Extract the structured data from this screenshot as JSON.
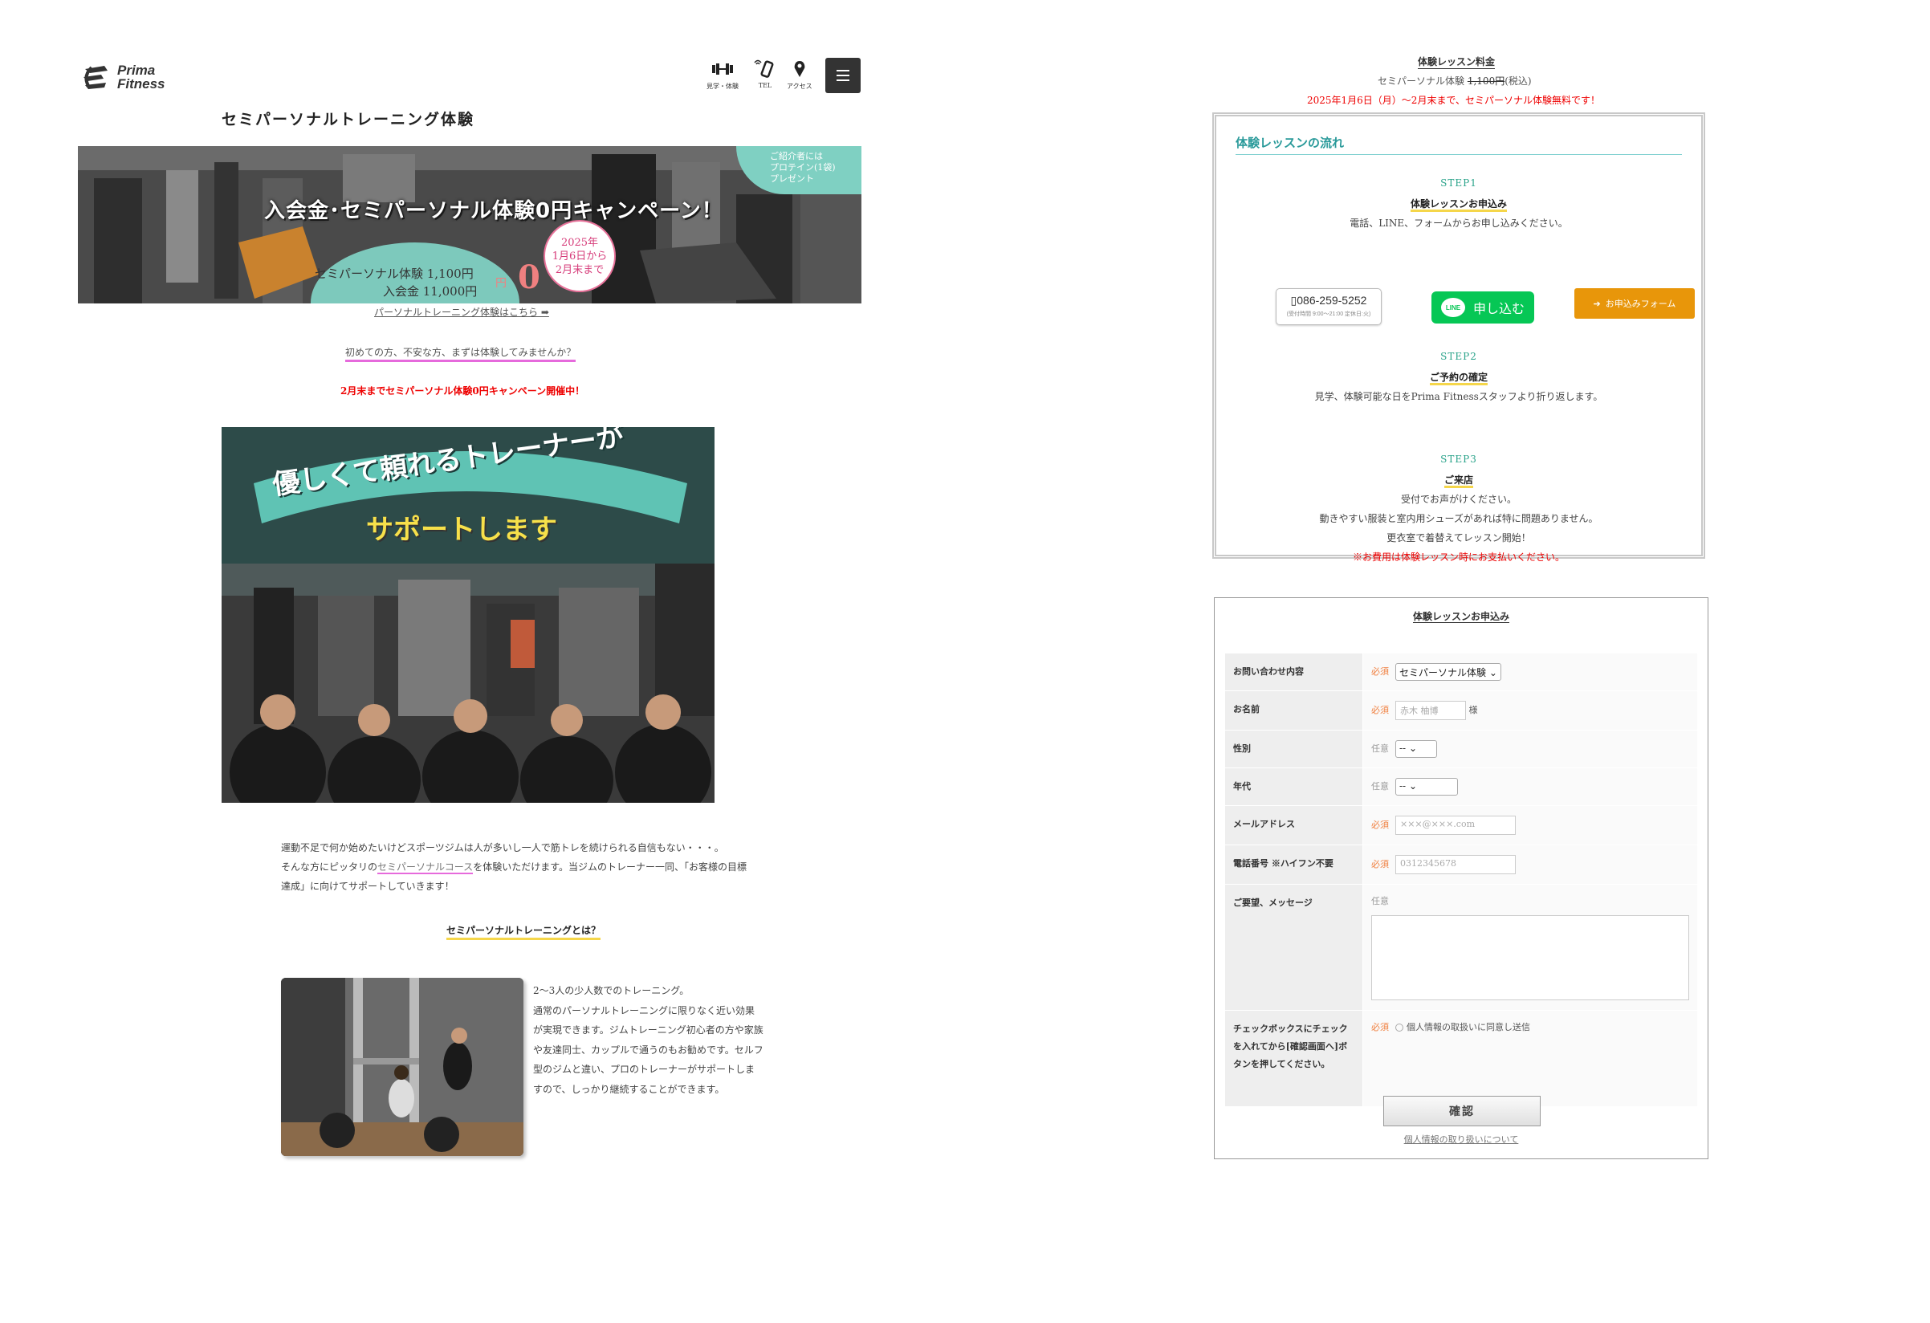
{
  "header": {
    "logo_line1": "Prima",
    "logo_line2": "Fitness",
    "nav": [
      {
        "label": "見学・体験",
        "icon": "dumbbell-icon"
      },
      {
        "label": "TEL",
        "icon": "phone-icon"
      },
      {
        "label": "アクセス",
        "icon": "map-pin-icon"
      }
    ]
  },
  "page_title": "セミパーソナルトレーニング体験",
  "banner": {
    "headline": "入会金･セミパーソナル体験0円キャンペーン！",
    "price1": "セミパーソナル体験 1,100円",
    "price2": "入会金 11,000円",
    "zero": "0",
    "yen": "円",
    "period": [
      "2025年",
      "1月6日から",
      "2月末まで"
    ],
    "promo": [
      "ご紹介者には",
      "プロテイン(1袋)",
      "プレゼント"
    ]
  },
  "links": {
    "personal": "パーソナルトレーニング体験はこちら ➡",
    "first_time": "初めての方、不安な方、まずは体験してみませんか？",
    "campaign": "2月末までセミパーソナル体験0円キャンペーン開催中！"
  },
  "trainer_image": {
    "line1": "優しくて頼れるトレーナーが",
    "line2": "サポートします"
  },
  "intro": {
    "line1": "運動不足で何か始めたいけどスポーツジムは人が多いし一人で筋トレを続けられる自信もない・・・。",
    "line2_pre": "そんな方にピッタリの",
    "line2_link": "セミパーソナルコース",
    "line2_post": "を体験いただけます。当ジムのトレーナー一同、「お客様の目標",
    "line3": "達成」に向けてサポートしていきます！"
  },
  "semi_what": "セミパーソナルトレーニングとは？",
  "session_text": [
    "2〜3人の少人数でのトレーニング。",
    "通常のパーソナルトレーニングに限りなく近い効果",
    "が実現できます。ジムトレーニング初心者の方や家族",
    "や友達同士、カップルで通うのもお勧めです。セルフ",
    "型のジムと違い、プロのトレーナーがサポートしま",
    "すので、しっかり継続することができます。"
  ],
  "price": {
    "title": "体験レッスン料金",
    "label": "セミパーソナル体験",
    "old": "1,100円",
    "tax": "(税込)",
    "campaign": "2025年1月6日（月）〜2月末まで、セミパーソナル体験無料です！"
  },
  "flow": {
    "title": "体験レッスンの流れ",
    "step1": {
      "label": "STEP1",
      "title": "体験レッスンお申込み",
      "text": "電話、LINE、フォームからお申し込みください。"
    },
    "tel": {
      "number": "086-259-5252",
      "hours": "(受付時間 9:00～21:00 定休日:火)"
    },
    "line": {
      "icon_text": "LINE",
      "label": "申し込む"
    },
    "form_btn": "お申込みフォーム",
    "step2": {
      "label": "STEP2",
      "title": "ご予約の確定",
      "text": "見学、体験可能な日をPrima Fitnessスタッフより折り返します。"
    },
    "step3": {
      "label": "STEP3",
      "title": "ご来店",
      "text1": "受付でお声がけください。",
      "text2": "動きやすい服装と室内用シューズがあれば特に問題ありません。",
      "text3": "更衣室で着替えてレッスン開始！",
      "note": "※お費用は体験レッスン時にお支払いください。"
    }
  },
  "form": {
    "title": "体験レッスンお申込み",
    "required": "必須",
    "optional": "任意",
    "rows": {
      "inquiry": {
        "label": "お問い合わせ内容",
        "value": "セミパーソナル体験"
      },
      "name": {
        "label": "お名前",
        "placeholder": "赤木 柚博",
        "suffix": "様"
      },
      "gender": {
        "label": "性別",
        "value": "--"
      },
      "age": {
        "label": "年代",
        "value": "--"
      },
      "email": {
        "label": "メールアドレス",
        "placeholder": "×××@×××.com"
      },
      "phone": {
        "label": "電話番号 ※ハイフン不要",
        "placeholder": "0312345678"
      },
      "message": {
        "label": "ご要望、メッセージ"
      },
      "consent": {
        "label": "チェックボックスにチェックを入れてから[確認画面へ]ボタンを押してください。",
        "text": "個人情報の取扱いに同意し送信"
      }
    },
    "confirm": "確認",
    "privacy": "個人情報の取り扱いについて"
  }
}
